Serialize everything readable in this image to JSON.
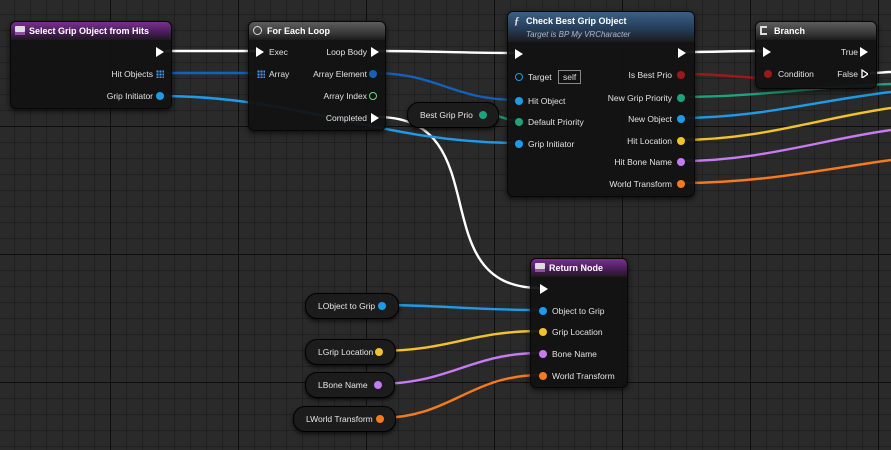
{
  "nodes": {
    "select_grip": {
      "title": "Select Grip Object from Hits",
      "pins": {
        "hit_objects": "Hit Objects",
        "grip_initiator": "Grip Initiator"
      }
    },
    "for_each": {
      "title": "For Each Loop",
      "pins": {
        "exec": "Exec",
        "array": "Array",
        "loop_body": "Loop Body",
        "array_element": "Array Element",
        "array_index": "Array Index",
        "completed": "Completed"
      }
    },
    "check_best": {
      "title": "Check Best Grip Object",
      "subtitle": "Target is BP My VRCharacter",
      "pins": {
        "target": "Target",
        "target_value": "self",
        "hit_object": "Hit Object",
        "default_priority": "Default Priority",
        "grip_initiator": "Grip Initiator",
        "is_best_prio": "Is Best Prio",
        "new_grip_priority": "New Grip Priority",
        "new_object": "New Object",
        "hit_location": "Hit Location",
        "hit_bone_name": "Hit Bone Name",
        "world_transform": "World Transform"
      }
    },
    "branch": {
      "title": "Branch",
      "pins": {
        "condition": "Condition",
        "true_label": "True",
        "false_label": "False"
      }
    },
    "return_node": {
      "title": "Return Node",
      "pins": {
        "object_to_grip": "Object to Grip",
        "grip_location": "Grip Location",
        "bone_name": "Bone Name",
        "world_transform": "World Transform"
      }
    },
    "vars": {
      "best_grip_prio": "Best Grip Prio",
      "lobject_to_grip": "LObject to Grip",
      "lgrip_location": "LGrip Location",
      "lbone_name": "LBone Name",
      "lworld_transform": "LWorld Transform"
    }
  },
  "colors": {
    "object_pin": "#1e9be8",
    "int_pin": "#1fa37f",
    "bool_pin": "#9a1a1a",
    "vector_pin": "#f2c12e",
    "name_pin": "#c77bf0",
    "transform_pin": "#f57a1e",
    "exec_pin": "#ffffff",
    "array_pin": "#4a8fe0",
    "array_index_pin": "#5fe08a"
  }
}
